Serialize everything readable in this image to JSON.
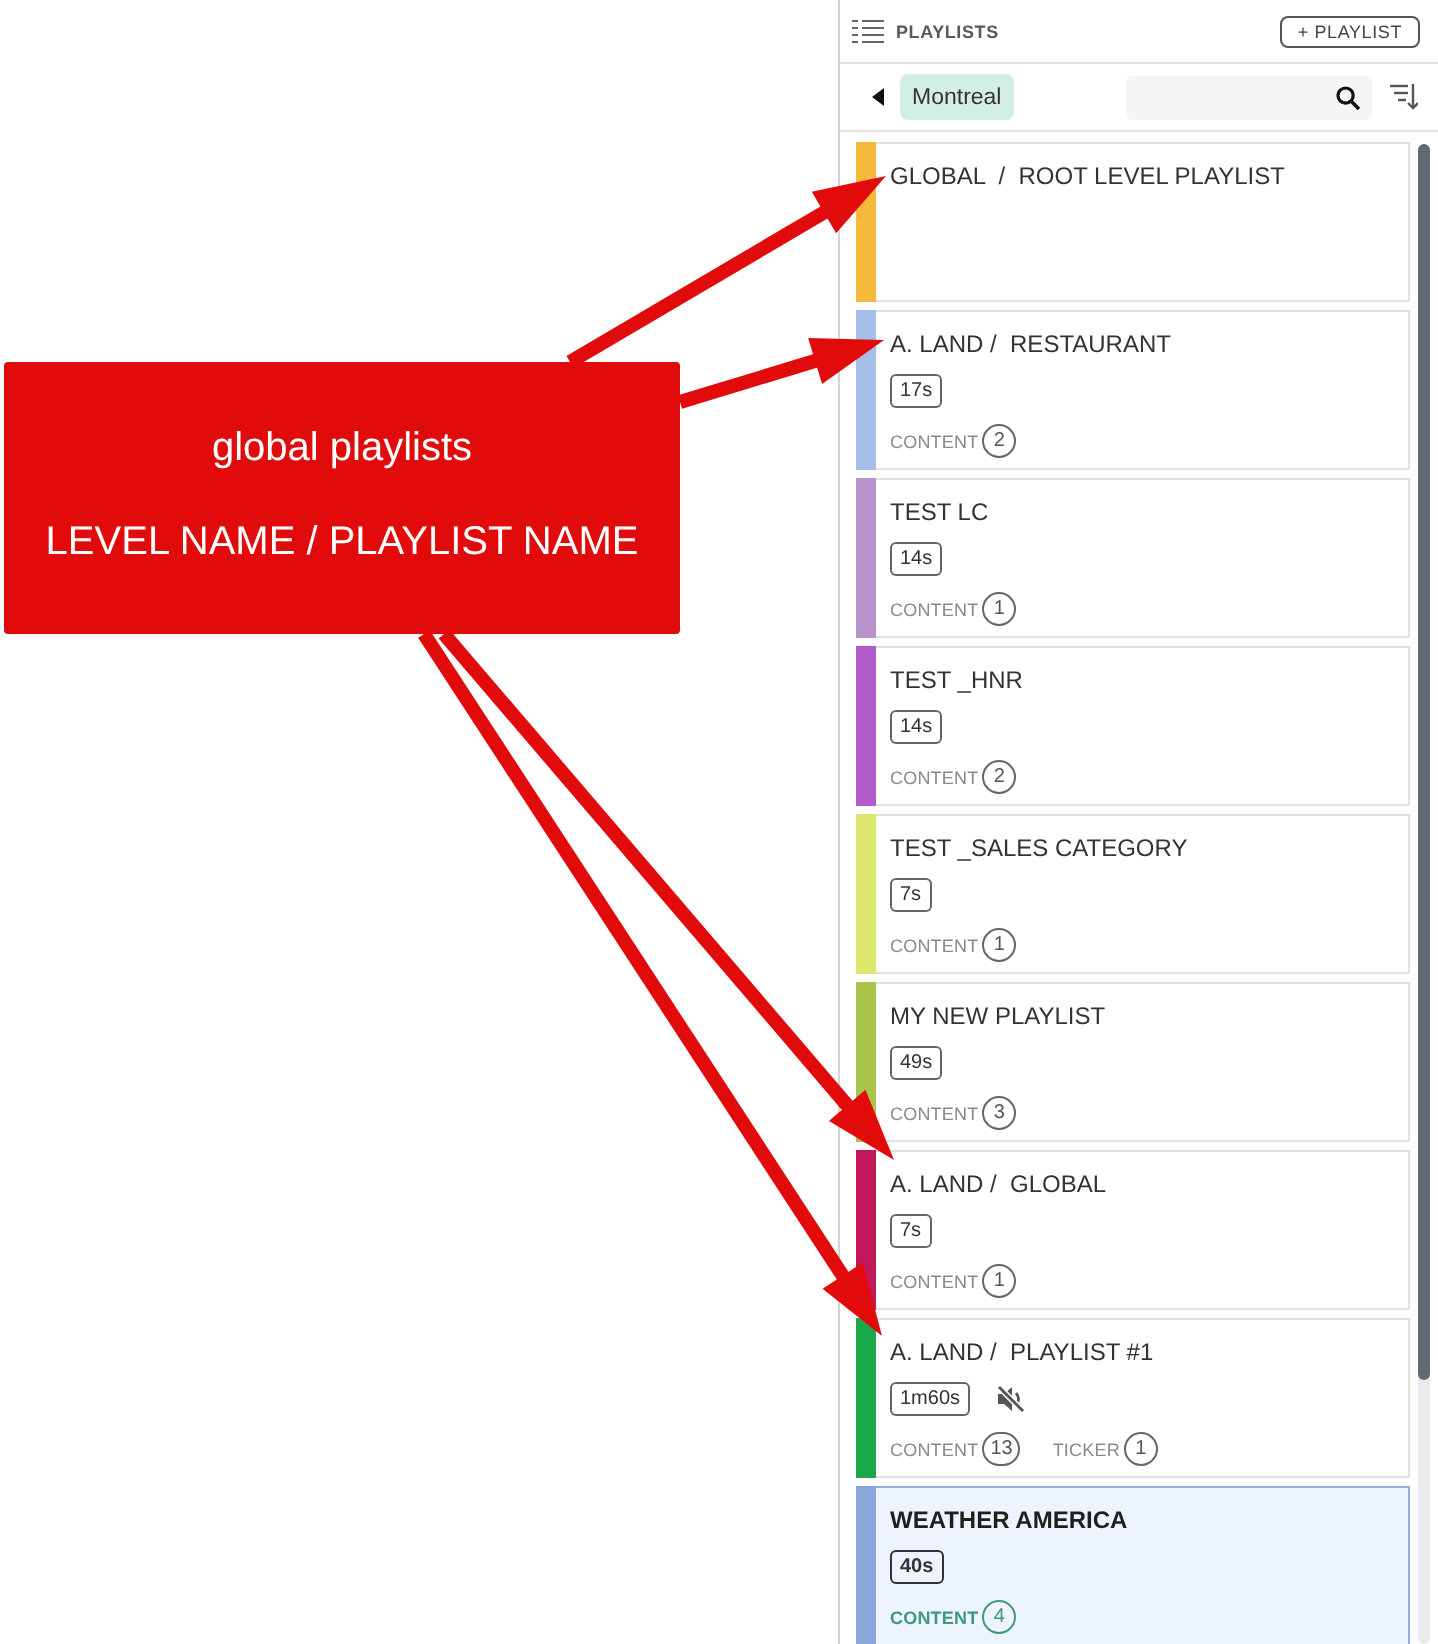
{
  "panel": {
    "title": "PLAYLISTS",
    "add_button": "+ PLAYLIST",
    "location": "Montreal"
  },
  "playlists": [
    {
      "title": "GLOBAL  /  ROOT LEVEL PLAYLIST",
      "color": "#f6b93b",
      "selected": false,
      "muted": false
    },
    {
      "title": "A. LAND /  RESTAURANT",
      "duration": "17s",
      "counts": [
        {
          "label": "CONTENT",
          "value": "2"
        }
      ],
      "color": "#a7bfe8",
      "selected": false,
      "muted": false
    },
    {
      "title": "TEST LC",
      "duration": "14s",
      "counts": [
        {
          "label": "CONTENT",
          "value": "1"
        }
      ],
      "color": "#b893cb",
      "selected": false,
      "muted": false
    },
    {
      "title": "TEST _HNR",
      "duration": "14s",
      "counts": [
        {
          "label": "CONTENT",
          "value": "2"
        }
      ],
      "color": "#b25ccb",
      "selected": false,
      "muted": false
    },
    {
      "title": "TEST _SALES CATEGORY",
      "duration": "7s",
      "counts": [
        {
          "label": "CONTENT",
          "value": "1"
        }
      ],
      "color": "#dce86c",
      "selected": false,
      "muted": false
    },
    {
      "title": "MY NEW PLAYLIST",
      "duration": "49s",
      "counts": [
        {
          "label": "CONTENT",
          "value": "3"
        }
      ],
      "color": "#a9c34b",
      "selected": false,
      "muted": false
    },
    {
      "title": "A. LAND /  GLOBAL",
      "duration": "7s",
      "counts": [
        {
          "label": "CONTENT",
          "value": "1"
        }
      ],
      "color": "#c2185b",
      "selected": false,
      "muted": false
    },
    {
      "title": "A. LAND /  PLAYLIST #1",
      "duration": "1m60s",
      "counts": [
        {
          "label": "CONTENT",
          "value": "13"
        },
        {
          "label": "TICKER",
          "value": "1"
        }
      ],
      "color": "#1ba84b",
      "selected": false,
      "muted": true
    },
    {
      "title": "WEATHER AMERICA",
      "duration": "40s",
      "counts": [
        {
          "label": "CONTENT",
          "value": "4"
        }
      ],
      "color": "#8aa5d9",
      "selected": true,
      "muted": false
    }
  ],
  "callout": {
    "heading": "global playlists",
    "subheading": "LEVEL NAME / PLAYLIST NAME"
  }
}
